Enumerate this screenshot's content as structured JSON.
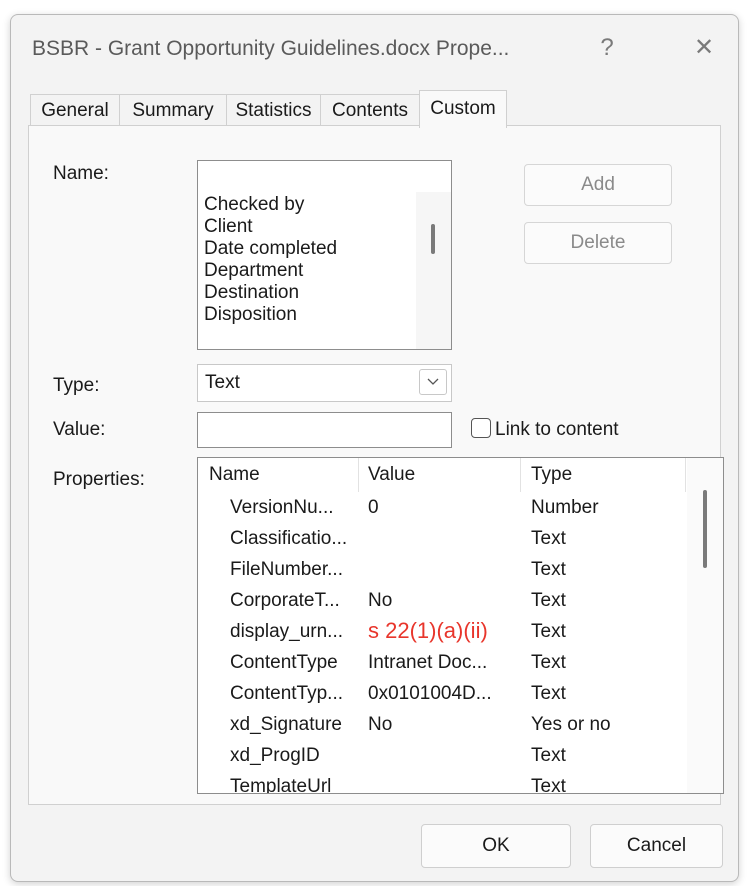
{
  "window": {
    "title": "BSBR - Grant Opportunity Guidelines.docx Prope...",
    "help_glyph": "?",
    "close_glyph": "✕"
  },
  "tabs": [
    {
      "label": "General",
      "active": false
    },
    {
      "label": "Summary",
      "active": false
    },
    {
      "label": "Statistics",
      "active": false
    },
    {
      "label": "Contents",
      "active": false
    },
    {
      "label": "Custom",
      "active": true
    }
  ],
  "custom": {
    "name_label": "Name:",
    "name_value": "",
    "name_options": [
      "Checked by",
      "Client",
      "Date completed",
      "Department",
      "Destination",
      "Disposition"
    ],
    "add_label": "Add",
    "delete_label": "Delete",
    "type_label": "Type:",
    "type_value": "Text",
    "value_label": "Value:",
    "value_value": "",
    "link_label": "Link to content",
    "link_checked": false,
    "properties_label": "Properties:",
    "columns": [
      "Name",
      "Value",
      "Type"
    ],
    "properties": [
      {
        "name": "VersionNu...",
        "value": "0",
        "type": "Number",
        "redacted": false
      },
      {
        "name": "Classificatio...",
        "value": "",
        "type": "Text",
        "redacted": false
      },
      {
        "name": "FileNumber...",
        "value": "",
        "type": "Text",
        "redacted": false
      },
      {
        "name": "CorporateT...",
        "value": "No",
        "type": "Text",
        "redacted": false
      },
      {
        "name": "display_urn...",
        "value": "s 22(1)(a)(ii)",
        "type": "Text",
        "redacted": true
      },
      {
        "name": "ContentType",
        "value": "Intranet Doc...",
        "type": "Text",
        "redacted": false
      },
      {
        "name": "ContentTyp...",
        "value": "0x0101004D...",
        "type": "Text",
        "redacted": false
      },
      {
        "name": "xd_Signature",
        "value": "No",
        "type": "Yes or no",
        "redacted": false
      },
      {
        "name": "xd_ProgID",
        "value": "",
        "type": "Text",
        "redacted": false
      },
      {
        "name": "TemplateUrl",
        "value": "",
        "type": "Text",
        "redacted": false
      }
    ]
  },
  "footer": {
    "ok_label": "OK",
    "cancel_label": "Cancel"
  },
  "colors": {
    "redaction_text": "#e8352b",
    "dialog_bg": "#f3f3f3",
    "panel_bg": "#f9f9f9"
  }
}
